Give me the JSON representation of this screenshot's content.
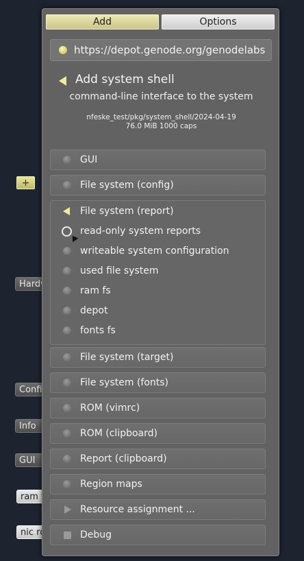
{
  "background_nodes": [
    {
      "label": "+"
    },
    {
      "label": "Hardware"
    },
    {
      "label": "Config"
    },
    {
      "label": "Info"
    },
    {
      "label": "GUI"
    },
    {
      "label": "ram fs"
    },
    {
      "label": "nic router"
    }
  ],
  "popup": {
    "tabs": [
      {
        "label": "Add",
        "active": true
      },
      {
        "label": "Options",
        "active": false
      }
    ],
    "depot_url": "https://depot.genode.org/genodelabs",
    "component": {
      "title": "Add system shell",
      "description": "command-line interface to the system",
      "path": "nfeske_test/pkg/system_shell/2024-04-19",
      "size": "76.0 MiB 1000 caps"
    },
    "items_top": [
      {
        "label": "GUI"
      },
      {
        "label": "File system (config)"
      }
    ],
    "expanded_group": {
      "label": "File system (report)",
      "options": [
        {
          "label": "read-only system reports",
          "hovered": true
        },
        {
          "label": "writeable system configuration"
        },
        {
          "label": "used file system"
        },
        {
          "label": "ram fs"
        },
        {
          "label": "depot"
        },
        {
          "label": "fonts fs"
        }
      ]
    },
    "items_bottom": [
      {
        "label": "File system (target)"
      },
      {
        "label": "File system (fonts)"
      },
      {
        "label": "ROM (vimrc)"
      },
      {
        "label": "ROM (clipboard)"
      },
      {
        "label": "Report (clipboard)"
      },
      {
        "label": "Region maps"
      },
      {
        "label": "Resource assignment ..."
      },
      {
        "label": "Debug"
      }
    ]
  },
  "colors": {
    "background": "#1d2430",
    "popup": "#626262",
    "accent_yellow": "#f2ea9a"
  }
}
